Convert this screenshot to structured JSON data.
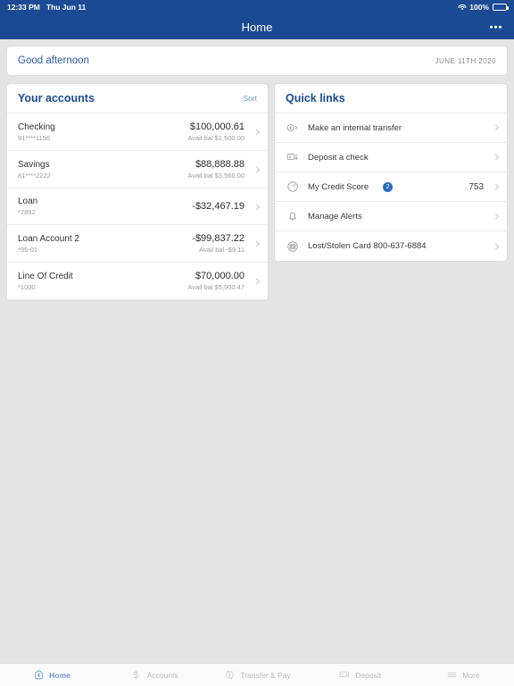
{
  "status_bar": {
    "time": "12:33 PM",
    "date": "Thu Jun 11",
    "battery_percent": "100%",
    "wifi_icon": "wifi-icon",
    "battery_icon": "battery-icon"
  },
  "nav": {
    "title": "Home",
    "more_icon": "more-dots-icon"
  },
  "greeting": {
    "text": "Good afternoon",
    "date": "JUNE 11TH 2020"
  },
  "accounts_panel": {
    "title": "Your accounts",
    "sort_label": "Sort",
    "rows": [
      {
        "name": "Checking",
        "mask": "91****1156",
        "balance": "$100,000.61",
        "available": "Avail bal $1,500.00"
      },
      {
        "name": "Savings",
        "mask": "81****2222",
        "balance": "$88,888.88",
        "available": "Avail bal $3,566.00"
      },
      {
        "name": "Loan",
        "mask": "*7892",
        "balance": "-$32,467.19",
        "available": ""
      },
      {
        "name": "Loan Account 2",
        "mask": "*95-01",
        "balance": "-$99,837.22",
        "available": "Avail bal -$9.11"
      },
      {
        "name": "Line Of Credit",
        "mask": "*1000",
        "balance": "$70,000.00",
        "available": "Avail bal $5,900.47"
      }
    ]
  },
  "quick_links": {
    "title": "Quick links",
    "rows": [
      {
        "label": "Make an internal transfer",
        "icon": "transfer-icon",
        "badge": "",
        "value": ""
      },
      {
        "label": "Deposit a check",
        "icon": "check-deposit-icon",
        "badge": "",
        "value": ""
      },
      {
        "label": "My Credit Score",
        "icon": "gauge-icon",
        "badge": "2",
        "value": "753"
      },
      {
        "label": "Manage Alerts",
        "icon": "bell-icon",
        "badge": "",
        "value": ""
      },
      {
        "label": "Lost/Stolen Card 800-637-6884",
        "icon": "card-icon",
        "badge": "",
        "value": ""
      }
    ]
  },
  "tab_bar": {
    "tabs": [
      {
        "label": "Home",
        "icon": "home-dollar-icon",
        "active": true
      },
      {
        "label": "Accounts",
        "icon": "dollar-sign-icon",
        "active": false
      },
      {
        "label": "Transfer & Pay",
        "icon": "transfer-circle-icon",
        "active": false
      },
      {
        "label": "Deposit",
        "icon": "check-icon",
        "active": false
      },
      {
        "label": "More",
        "icon": "hamburger-icon",
        "active": false
      }
    ]
  },
  "colors": {
    "header_blue": "#1b4a94",
    "link_blue": "#6d94cf",
    "badge_blue": "#2a6bc4",
    "page_bg": "#e4e4e4"
  }
}
